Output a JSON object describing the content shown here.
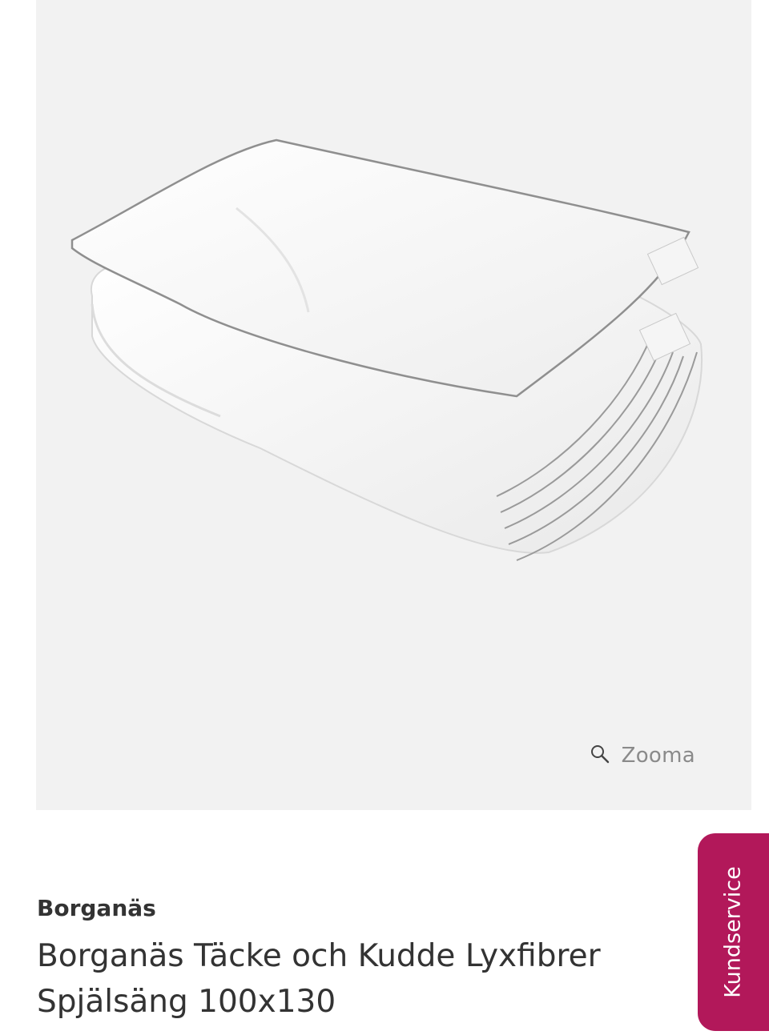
{
  "product": {
    "zoom_label": "Zooma",
    "brand": "Borganäs",
    "title": "Borganäs Täcke och Kudde Lyxfibrer Spjälsäng 100x130"
  },
  "support_tab": {
    "label": "Kundservice",
    "color": "#b2185a"
  },
  "icons": {
    "zoom": "magnifier-icon"
  }
}
